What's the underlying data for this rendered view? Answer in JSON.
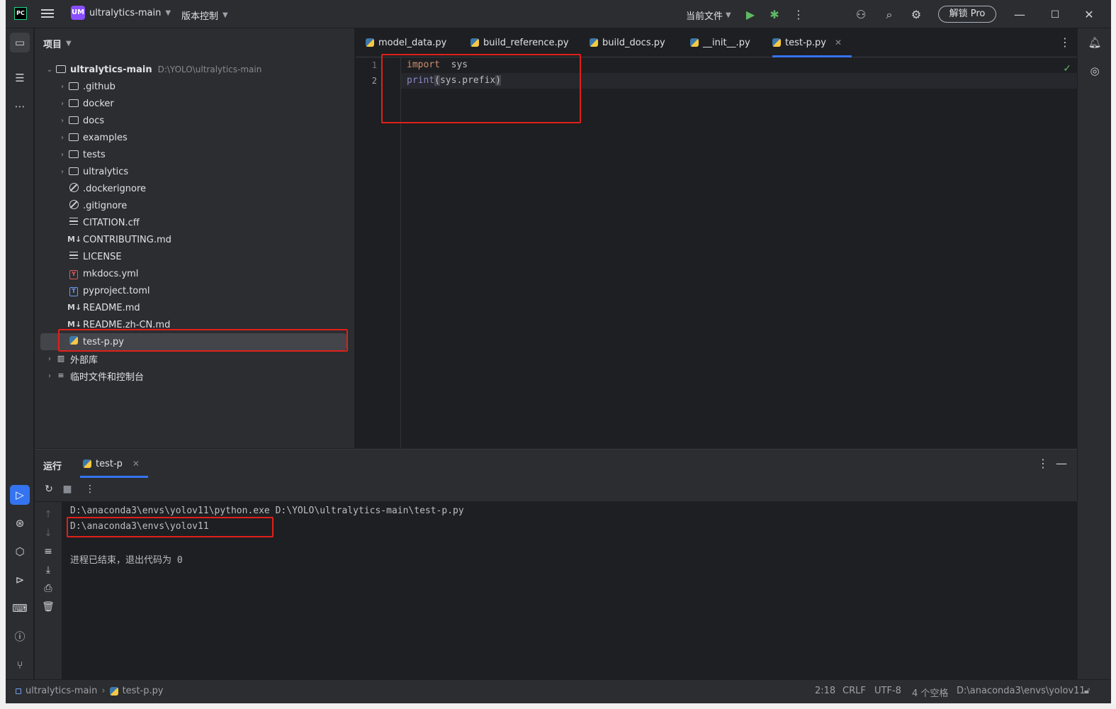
{
  "titlebar": {
    "logo": "PC",
    "project_badge": "UM",
    "project_name": "ultralytics-main",
    "vcs_label": "版本控制",
    "run_config": "当前文件",
    "pro_button": "解锁 Pro"
  },
  "project_panel": {
    "title": "项目",
    "root": {
      "name": "ultralytics-main",
      "path": "D:\\YOLO\\ultralytics-main"
    },
    "folders": [
      {
        "name": ".github"
      },
      {
        "name": "docker"
      },
      {
        "name": "docs"
      },
      {
        "name": "examples"
      },
      {
        "name": "tests"
      },
      {
        "name": "ultralytics"
      }
    ],
    "files": [
      {
        "name": ".dockerignore",
        "icon": "ignore-icon"
      },
      {
        "name": ".gitignore",
        "icon": "ignore-icon"
      },
      {
        "name": "CITATION.cff",
        "icon": "text-file-icon"
      },
      {
        "name": "CONTRIBUTING.md",
        "icon": "markdown-icon"
      },
      {
        "name": "LICENSE",
        "icon": "text-file-icon"
      },
      {
        "name": "mkdocs.yml",
        "icon": "yaml-icon"
      },
      {
        "name": "pyproject.toml",
        "icon": "toml-icon"
      },
      {
        "name": "README.md",
        "icon": "markdown-icon"
      },
      {
        "name": "README.zh-CN.md",
        "icon": "markdown-icon"
      },
      {
        "name": "test-p.py",
        "icon": "python-icon"
      }
    ],
    "external_libs": "外部库",
    "scratches": "临时文件和控制台"
  },
  "editor": {
    "tabs": [
      {
        "label": "model_data.py"
      },
      {
        "label": "build_reference.py"
      },
      {
        "label": "build_docs.py"
      },
      {
        "label": "__init__.py"
      },
      {
        "label": "test-p.py"
      }
    ],
    "line_numbers": [
      "1",
      "2"
    ],
    "code": {
      "line1_kw": "import",
      "line1_rest": "  sys",
      "line2_fn": "print",
      "line2_open": "(",
      "line2_arg": "sys.prefix",
      "line2_close": ")"
    }
  },
  "run_panel": {
    "title": "运行",
    "tab_label": "test-p",
    "console": [
      "D:\\anaconda3\\envs\\yolov11\\python.exe D:\\YOLO\\ultralytics-main\\test-p.py",
      "D:\\anaconda3\\envs\\yolov11",
      "",
      "进程已结束，退出代码为 0"
    ]
  },
  "statusbar": {
    "project": "ultralytics-main",
    "file": "test-p.py",
    "position": "2:18",
    "line_ending": "CRLF",
    "encoding": "UTF-8",
    "indent": "4 个空格",
    "interpreter": "D:\\anaconda3\\envs\\yolov11"
  },
  "colors": {
    "accent": "#3574f0",
    "highlight_box": "#e0201a",
    "background": "#1e1f22",
    "panel": "#2b2d30"
  }
}
